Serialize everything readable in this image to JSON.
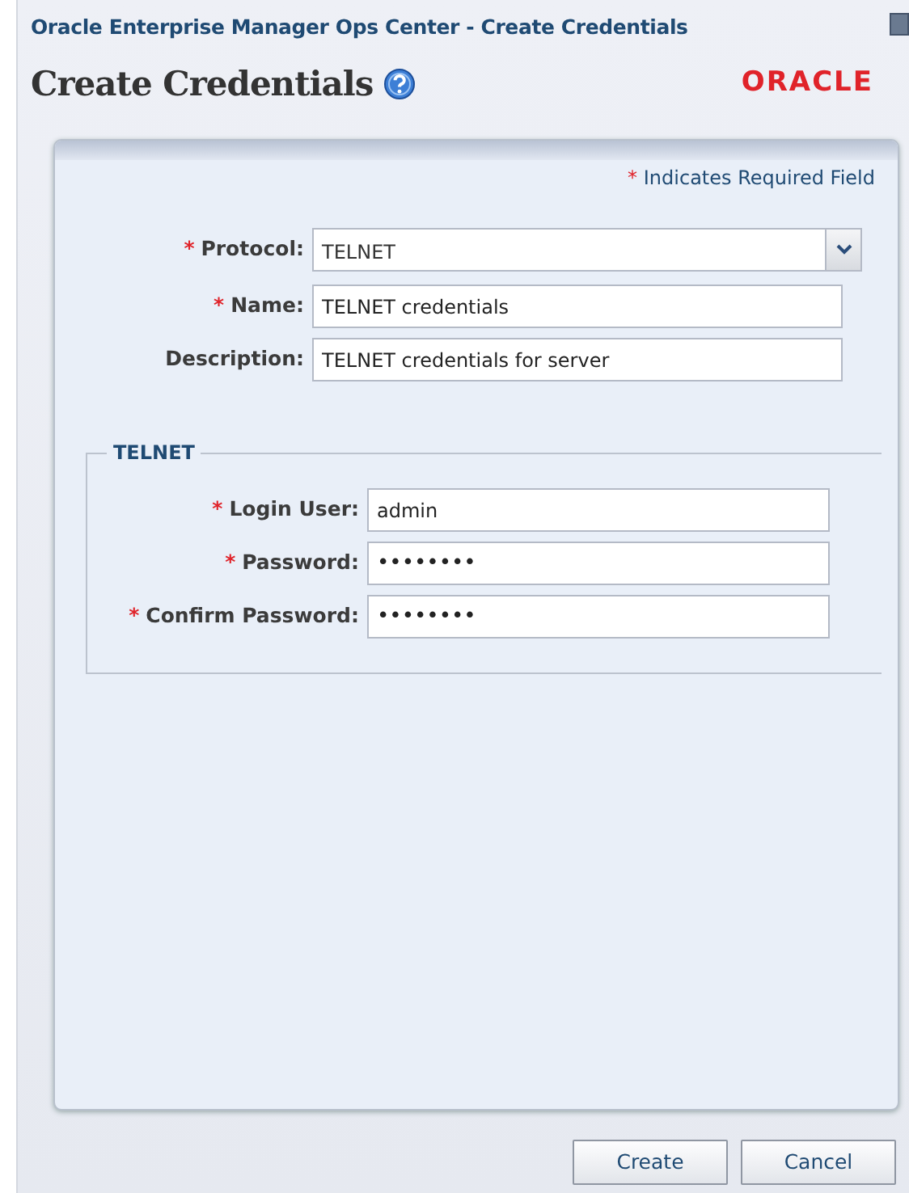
{
  "window": {
    "title": "Oracle Enterprise Manager Ops Center - Create Credentials"
  },
  "heading": "Create Credentials",
  "logo": "ORACLE",
  "required_note": {
    "mark": "*",
    "text": "Indicates Required Field"
  },
  "fields": [
    {
      "label": "Protocol:",
      "required": true,
      "kind": "select",
      "value": "TELNET"
    },
    {
      "label": "Name:",
      "required": true,
      "kind": "text",
      "value": "TELNET credentials"
    },
    {
      "label": "Description:",
      "required": false,
      "kind": "text",
      "value": "TELNET credentials for server"
    }
  ],
  "section": {
    "title": "TELNET",
    "fields": [
      {
        "label": "Login User:",
        "required": true,
        "kind": "text",
        "value": "admin"
      },
      {
        "label": "Password:",
        "required": true,
        "kind": "password",
        "value": "••••••••"
      },
      {
        "label": "Confirm Password:",
        "required": true,
        "kind": "password",
        "value": "••••••••"
      }
    ]
  },
  "buttons": [
    "Create",
    "Cancel"
  ]
}
